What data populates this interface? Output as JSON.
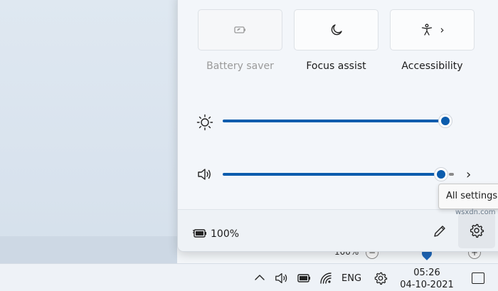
{
  "quick_settings": {
    "tiles": [
      {
        "label": "Battery saver",
        "icon": "battery-saver-icon",
        "enabled": false
      },
      {
        "label": "Focus assist",
        "icon": "moon-icon",
        "enabled": true
      },
      {
        "label": "Accessibility",
        "icon": "accessibility-icon",
        "enabled": true,
        "has_chevron": true
      }
    ],
    "brightness": {
      "icon": "sun-icon",
      "value_percent": 100
    },
    "volume": {
      "icon": "speaker-icon",
      "value_percent": 98
    },
    "footer": {
      "battery_text": "100%",
      "battery_icon": "battery-charging-icon"
    },
    "tooltip": "All settings"
  },
  "background_window": {
    "zoom_text": "100%"
  },
  "taskbar": {
    "language": "ENG",
    "time": "05:26",
    "date": "04-10-2021"
  },
  "watermark": "wsxdn.com",
  "colors": {
    "accent": "#0b5cad"
  }
}
